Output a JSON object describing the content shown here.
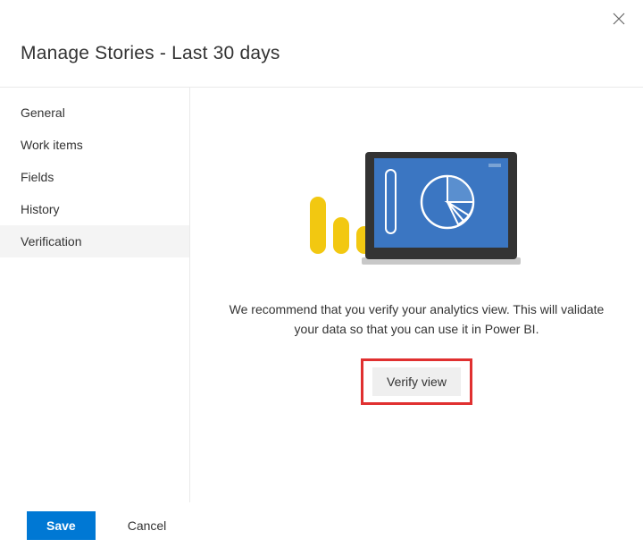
{
  "header": {
    "title": "Manage Stories - Last 30 days"
  },
  "sidebar": {
    "items": [
      {
        "label": "General",
        "selected": false
      },
      {
        "label": "Work items",
        "selected": false
      },
      {
        "label": "Fields",
        "selected": false
      },
      {
        "label": "History",
        "selected": false
      },
      {
        "label": "Verification",
        "selected": true
      }
    ]
  },
  "main": {
    "description": "We recommend that you verify your analytics view. This will validate your data so that you can use it in Power BI.",
    "verify_label": "Verify view"
  },
  "footer": {
    "save_label": "Save",
    "cancel_label": "Cancel"
  }
}
